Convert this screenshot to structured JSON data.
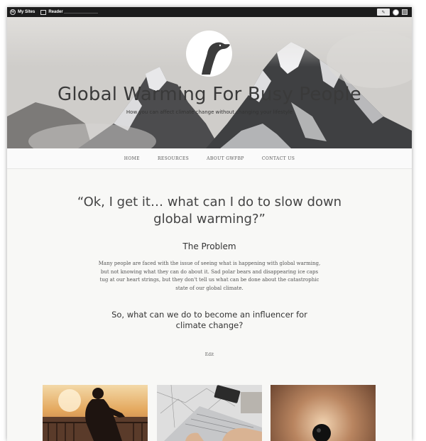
{
  "admin_bar": {
    "my_sites_label": "My Sites",
    "reader_label": "Reader"
  },
  "site": {
    "title": "Global Warming For Busy People",
    "tagline": "How you can affect climate change without changing your lifestyle"
  },
  "nav": {
    "items": [
      "HOME",
      "RESOURCES",
      "ABOUT GWFBP",
      "CONTACT US"
    ]
  },
  "content": {
    "quote": "“Ok, I get it… what can I do to slow down global warming?”",
    "problem_heading": "The Problem",
    "problem_text": "Many people are faced with the issue of seeing what is happening with global warming, but not knowing what they can do about it. Sad polar bears and disappearing ice caps tug at our heart strings, but they don't tell us what can be done about the catastrophic state of our global climate.",
    "question_heading": "So, what can we do to become an influencer for climate change?",
    "edit_link": "Edit"
  },
  "thumbnails": {
    "items": [
      "cyclist-sunset-photo",
      "laptop-map-photo",
      "microphone-photo"
    ]
  },
  "colors": {
    "admin_bar": "#1c1c1c",
    "title_text": "#3a3a3a",
    "page_bg": "#f8f8f6"
  }
}
